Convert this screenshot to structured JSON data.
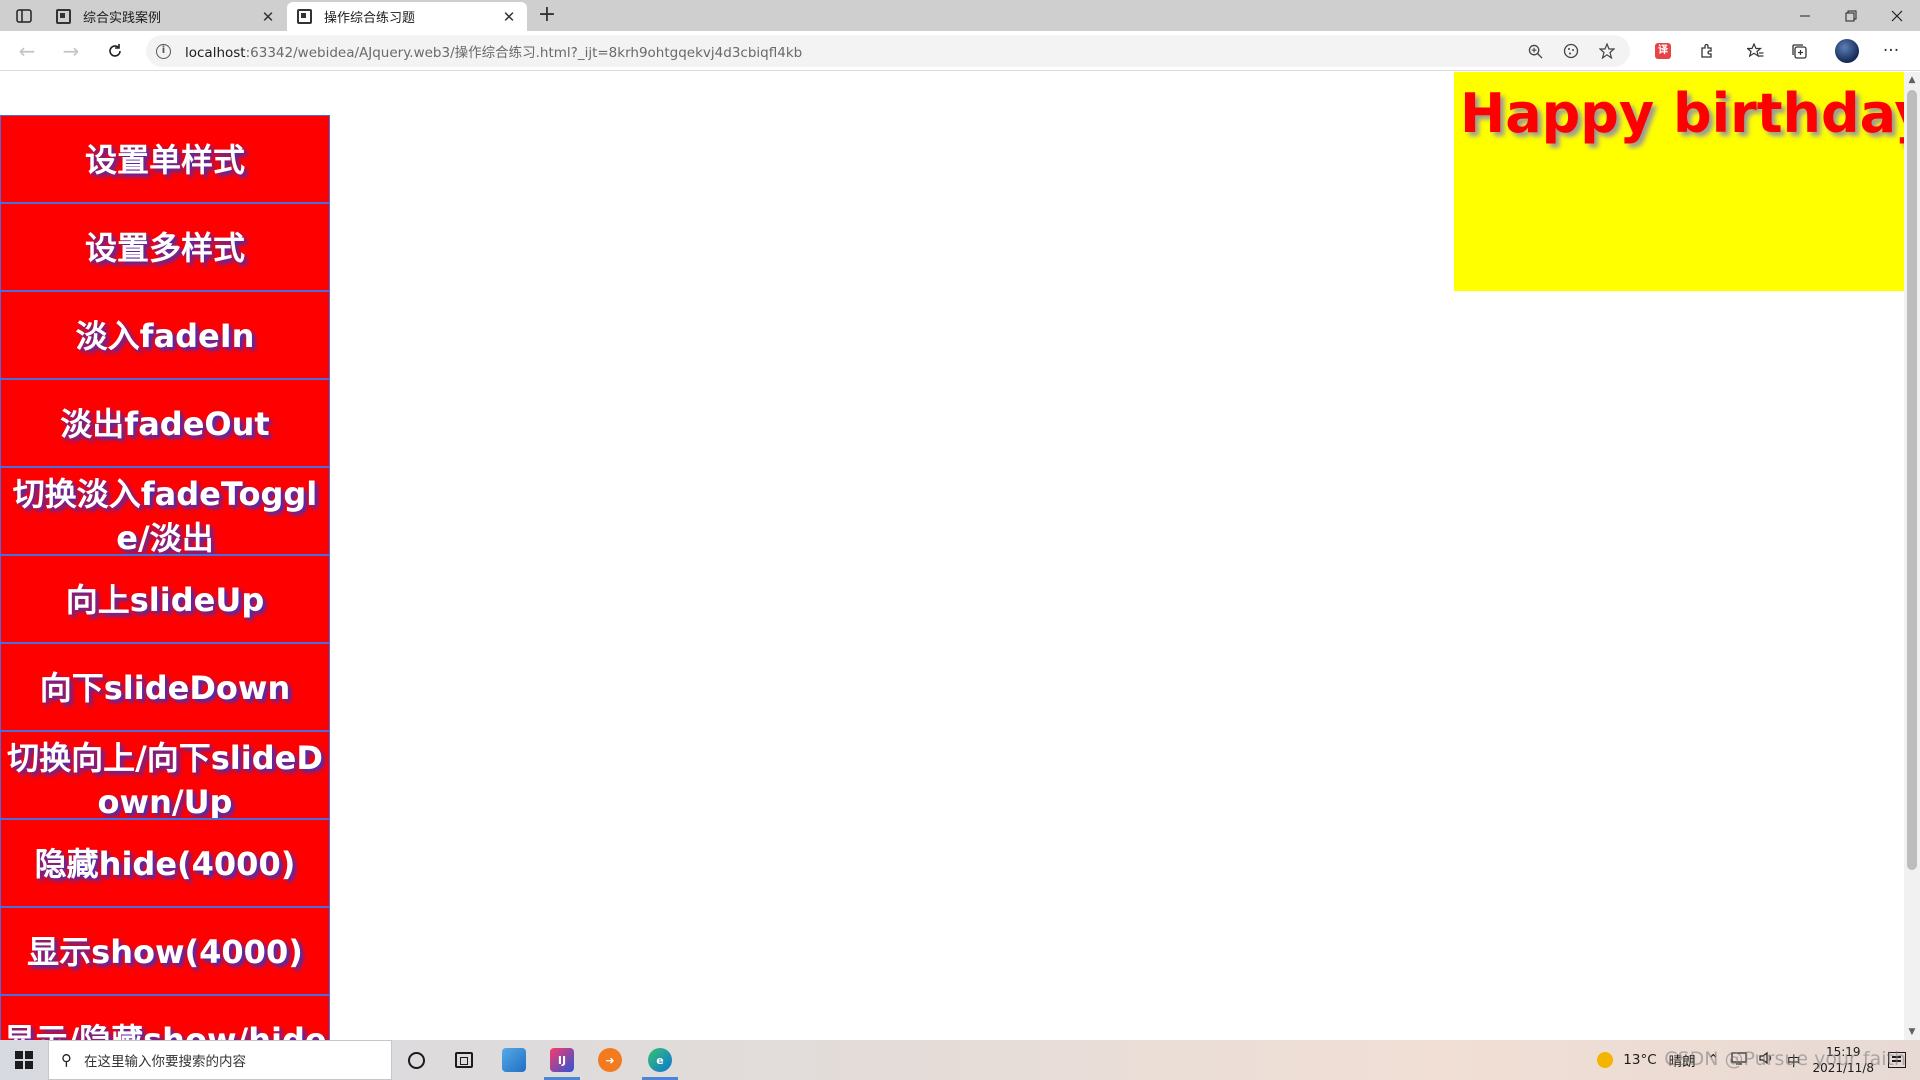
{
  "browser": {
    "tabs": [
      {
        "title": "综合实践案例",
        "active": false
      },
      {
        "title": "操作综合练习题",
        "active": true
      }
    ],
    "new_tab_symbol": "+",
    "close_symbol": "✕",
    "address": {
      "host": "localhost",
      "rest": ":63342/webidea/AJquery.web3/操作综合练习.html?_ijt=8krh9ohtgqekvj4d3cbiqfl4kb"
    }
  },
  "page": {
    "buttons": [
      {
        "label": "设置单样式"
      },
      {
        "label": "设置多样式"
      },
      {
        "label": "淡入fadeIn"
      },
      {
        "label": "淡出fadeOut"
      },
      {
        "label": "切换淡入fadeToggle/淡出"
      },
      {
        "label": "向上slideUp"
      },
      {
        "label": "向下slideDown"
      },
      {
        "label": "切换向上/向下slideDown/Up"
      },
      {
        "label": "隐藏hide(4000)"
      },
      {
        "label": "显示show(4000)"
      },
      {
        "label": "显示/隐藏show/hide"
      }
    ],
    "banner_text": "Happy birthday",
    "colors": {
      "button_bg": "#ff0000",
      "button_text": "#ffffff",
      "banner_bg": "#ffff00",
      "banner_text": "#ff0000"
    }
  },
  "taskbar": {
    "search_placeholder": "在这里输入你要搜索的内容",
    "weather": {
      "temp": "13°C",
      "condition": "晴朗"
    },
    "time": "15:19",
    "date": "2021/11/8",
    "ime": "中"
  },
  "watermark": "CSDN @Pursue your faith"
}
